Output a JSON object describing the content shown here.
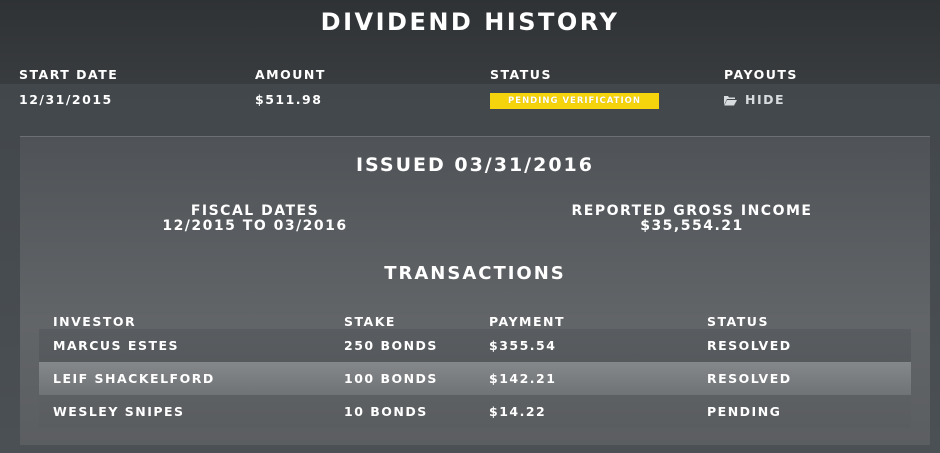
{
  "page": {
    "title": "DIVIDEND HISTORY"
  },
  "summary": {
    "headers": {
      "start_date": "START DATE",
      "amount": "AMOUNT",
      "status": "STATUS",
      "payouts": "PAYOUTS"
    },
    "start_date": "12/31/2015",
    "amount": "$511.98",
    "status": "PENDING VERIFICATION",
    "payouts_toggle": "HIDE",
    "status_color": "#f6d40d"
  },
  "details": {
    "issued": "ISSUED 03/31/2016",
    "fiscal_label": "FISCAL DATES",
    "fiscal_value": "12/2015 TO 03/2016",
    "income_label": "REPORTED GROSS INCOME",
    "income_value": "$35,554.21",
    "transactions_title": "TRANSACTIONS",
    "columns": {
      "investor": "INVESTOR",
      "stake": "STAKE",
      "payment": "PAYMENT",
      "status": "STATUS"
    },
    "rows": [
      {
        "investor": "MARCUS ESTES",
        "stake": "250 BONDS",
        "payment": "$355.54",
        "status": "RESOLVED"
      },
      {
        "investor": "LEIF SHACKELFORD",
        "stake": "100 BONDS",
        "payment": "$142.21",
        "status": "RESOLVED"
      },
      {
        "investor": "WESLEY SNIPES",
        "stake": "10 BONDS",
        "payment": "$14.22",
        "status": "PENDING"
      }
    ]
  },
  "icons": {
    "payouts_toggle": "folder-open-icon"
  }
}
